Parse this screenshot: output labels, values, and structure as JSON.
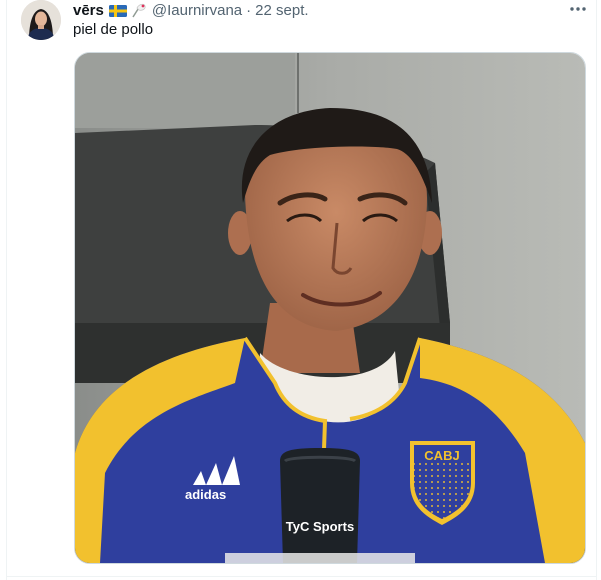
{
  "tweet": {
    "display_name": "vērs",
    "flag_icon": "sweden-flag-icon",
    "extra_emoji_icon": "rose-icon",
    "handle": "@Iaurnirvana",
    "separator": "·",
    "date": "22 sept.",
    "text": "piel de pollo",
    "more_icon": "more-dots-icon"
  },
  "media": {
    "microphone_label": "TyC Sports",
    "crest_label": "CABJ",
    "brand_label": "adidas"
  },
  "colors": {
    "text_primary": "#0f1419",
    "text_secondary": "#536471",
    "jersey_blue": "#2f3f9e",
    "jersey_yellow": "#f2c12e"
  }
}
